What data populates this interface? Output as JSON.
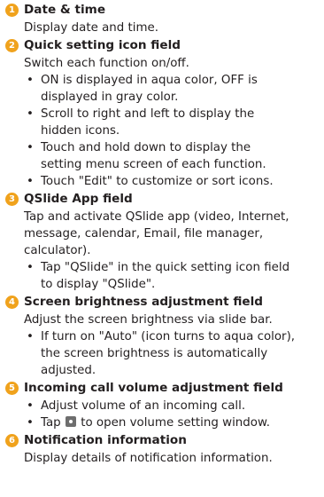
{
  "sections": [
    {
      "number": "1",
      "title": "Date & time",
      "desc_lines": [
        "Display date and time."
      ],
      "bullets": []
    },
    {
      "number": "2",
      "title": "Quick setting icon field",
      "desc_lines": [
        "Switch each function on/off."
      ],
      "bullets": [
        [
          "ON is displayed in aqua color, OFF is",
          "displayed in gray color."
        ],
        [
          "Scroll to right and left to display the",
          "hidden icons."
        ],
        [
          "Touch and hold down to display the",
          "setting menu screen of each function."
        ],
        [
          "Touch \"Edit\" to customize or sort icons."
        ]
      ]
    },
    {
      "number": "3",
      "title": "QSlide App field",
      "desc_lines": [
        "Tap and activate QSlide app (video, Internet,",
        "message, calendar, Email, file manager,",
        "calculator)."
      ],
      "bullets": [
        [
          "Tap \"QSlide\" in the quick setting icon field",
          "to display \"QSlide\"."
        ]
      ]
    },
    {
      "number": "4",
      "title": "Screen brightness adjustment field",
      "desc_lines": [
        "Adjust the screen brightness via slide bar."
      ],
      "bullets": [
        [
          "If turn on \"Auto\" (icon turns to aqua color),",
          "the screen brightness is automatically",
          "adjusted."
        ]
      ]
    },
    {
      "number": "5",
      "title": "Incoming call volume adjustment field",
      "desc_lines": [],
      "bullets": [
        [
          "Adjust volume of an incoming call."
        ]
      ],
      "icon_bullet": {
        "before": "Tap",
        "icon": "volume-settings-icon",
        "after": "to open volume setting window."
      }
    },
    {
      "number": "6",
      "title": "Notification information",
      "desc_lines": [
        "Display details of notification information."
      ],
      "bullets": []
    }
  ],
  "colors": {
    "number_badge": "#f0a21c",
    "text": "#231f20",
    "icon": "#6e6e6e"
  }
}
